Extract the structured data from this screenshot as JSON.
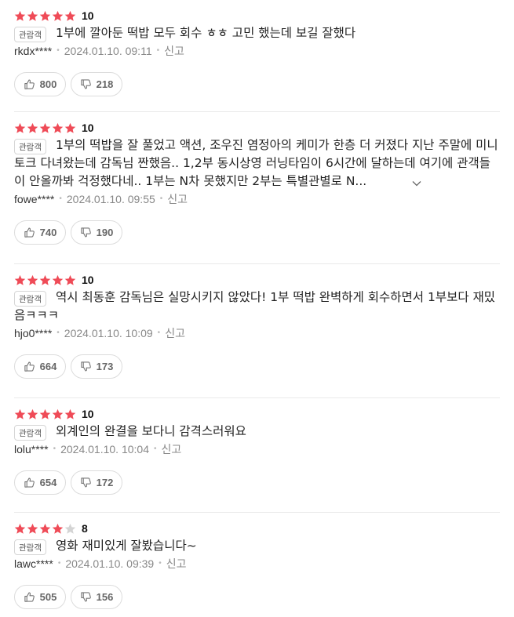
{
  "colors": {
    "star_on": "#ef4b57",
    "star_off": "#d4d4d4"
  },
  "reviews": [
    {
      "score": "10",
      "stars_filled": 5,
      "badge": "관람객",
      "text": "1부에 깔아둔 떡밥 모두 회수 ㅎㅎ 고민 했는데 보길 잘했다",
      "author": "rkdx****",
      "date": "2024.01.10. 09:11",
      "report": "신고",
      "likes": "800",
      "dislikes": "218",
      "truncated": false
    },
    {
      "score": "10",
      "stars_filled": 5,
      "badge": "관람객",
      "text": "1부의 떡밥을 잘 풀었고 액션, 조우진 염정아의 케미가 한층 더 커졌다 지난 주말에 미니토크 다녀왔는데 감독님 짠했음.. 1,2부 동시상영 러닝타임이 6시간에 달하는데 여기에 관객들이 안올까봐 걱정했다네.. 1부는 N차 못했지만 2부는 특별관별로 N...",
      "author": "fowe****",
      "date": "2024.01.10. 09:55",
      "report": "신고",
      "likes": "740",
      "dislikes": "190",
      "truncated": true
    },
    {
      "score": "10",
      "stars_filled": 5,
      "badge": "관람객",
      "text": "역시 최동훈 감독님은 실망시키지 않았다! 1부 떡밥 완벽하게 회수하면서 1부보다 재밌음ㅋㅋㅋ",
      "author": "hjo0****",
      "date": "2024.01.10. 10:09",
      "report": "신고",
      "likes": "664",
      "dislikes": "173",
      "truncated": false
    },
    {
      "score": "10",
      "stars_filled": 5,
      "badge": "관람객",
      "text": "외계인의 완결을 보다니 감격스러워요",
      "author": "lolu****",
      "date": "2024.01.10. 10:04",
      "report": "신고",
      "likes": "654",
      "dislikes": "172",
      "truncated": false
    },
    {
      "score": "8",
      "stars_filled": 4,
      "badge": "관람객",
      "text": "영화 재미있게 잘봤습니다~",
      "author": "lawc****",
      "date": "2024.01.10. 09:39",
      "report": "신고",
      "likes": "505",
      "dislikes": "156",
      "truncated": false
    }
  ]
}
